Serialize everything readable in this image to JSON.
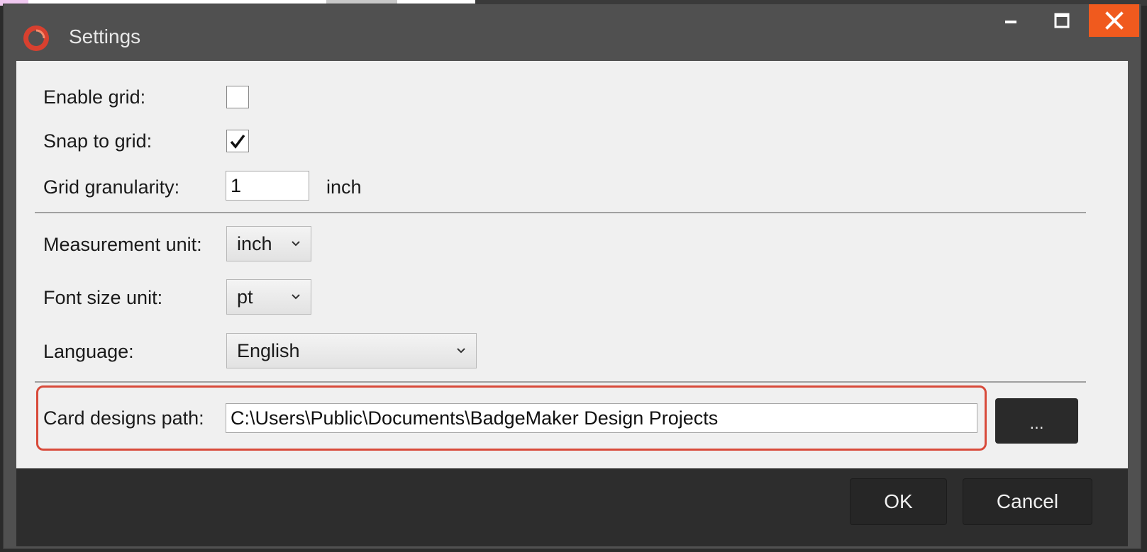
{
  "window": {
    "title": "Settings",
    "accent_color": "#f05a1e",
    "controls": [
      "minimize-icon",
      "maximize-icon",
      "close-icon"
    ]
  },
  "settings": {
    "enable_grid": {
      "label": "Enable grid:",
      "checked": false
    },
    "snap_to_grid": {
      "label": "Snap to grid:",
      "checked": true
    },
    "grid_granularity": {
      "label": "Grid granularity:",
      "value": "1",
      "unit": "inch"
    },
    "measurement_unit": {
      "label": "Measurement unit:",
      "value": "inch"
    },
    "font_size_unit": {
      "label": "Font size unit:",
      "value": "pt"
    },
    "language": {
      "label": "Language:",
      "value": "English"
    },
    "card_designs_path": {
      "label": "Card designs path:",
      "value": "C:\\Users\\Public\\Documents\\BadgeMaker Design Projects",
      "browse_label": "..."
    }
  },
  "footer": {
    "ok_label": "OK",
    "cancel_label": "Cancel"
  }
}
